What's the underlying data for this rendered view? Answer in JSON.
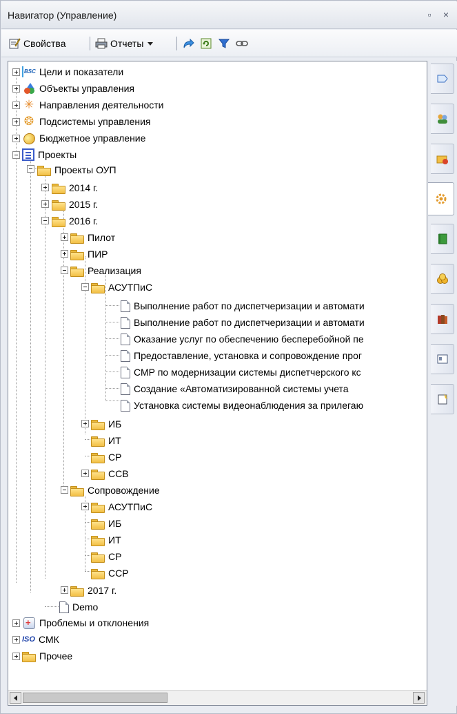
{
  "window": {
    "title": "Навигатор (Управление)",
    "pin_glyph": "▫",
    "close_glyph": "×"
  },
  "toolbar": {
    "properties_label": "Свойства",
    "reports_label": "Отчеты"
  },
  "tree": {
    "n0": "Цели и показатели",
    "n1": "Объекты управления",
    "n2": "Направления деятельности",
    "n3": "Подсистемы управления",
    "n4": "Бюджетное управление",
    "n5": "Проекты",
    "n6": "Проекты ОУП",
    "n7": "2014 г.",
    "n8": "2015 г.",
    "n9": "2016 г.",
    "n10": "Пилот",
    "n11": "ПИР",
    "n12": "Реализация",
    "n13": "АСУТПиС",
    "n14": "Выполнение работ по диспетчеризации и автомати",
    "n15": "Выполнение работ по диспетчеризации и автомати",
    "n16": "Оказание услуг по обеспечению бесперебойной пе",
    "n17": "Предоставление, установка и сопровождение прог",
    "n18": "СМР по модернизации системы диспетчерского кс",
    "n19": "Создание «Автоматизированной системы учета",
    "n20": "Установка системы видеонаблюдения за прилегаю",
    "n21": "ИБ",
    "n22": "ИТ",
    "n23": "СР",
    "n24": "ССВ",
    "n25": "Сопровождение",
    "n26": "АСУТПиС",
    "n27": "ИБ",
    "n28": "ИТ",
    "n29": "СР",
    "n30": "ССР",
    "n31": "2017 г.",
    "n32": "Demo",
    "n33": "Проблемы и отклонения",
    "n34": "СМК",
    "n35": "Прочее"
  },
  "icons": {
    "properties": "properties-icon",
    "reports": "printer-icon",
    "go": "arrow-icon",
    "refresh": "refresh-icon",
    "filter": "filter-icon",
    "link": "link-icon"
  },
  "sidebar_tabs": [
    "goals",
    "users",
    "objects",
    "subsystems",
    "book",
    "coins",
    "library",
    "card",
    "new-doc"
  ],
  "colors": {
    "folder": "#f2bf45",
    "accent": "#3a5bc8"
  }
}
